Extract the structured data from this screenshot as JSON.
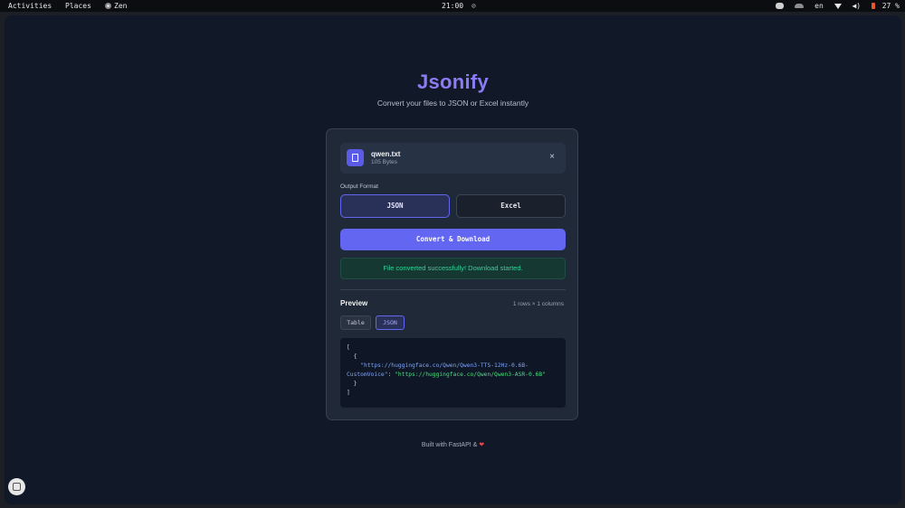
{
  "topbar": {
    "activities": "Activities",
    "places": "Places",
    "app": "Zen",
    "clock": "21:00",
    "language": "en",
    "battery": "27 %"
  },
  "app": {
    "title": "Jsonify",
    "subtitle": "Convert your files to JSON or Excel instantly"
  },
  "file": {
    "name": "qwen.txt",
    "size": "105 Bytes",
    "remove": "×"
  },
  "output": {
    "label": "Output Format",
    "json": "JSON",
    "excel": "Excel",
    "selected": "JSON"
  },
  "convert_label": "Convert & Download",
  "status_message": "File converted successfully! Download started.",
  "preview": {
    "title": "Preview",
    "meta": "1 rows × 1 columns",
    "tabs": [
      "Table",
      "JSON"
    ],
    "active_tab": "JSON",
    "code": {
      "line1": "[",
      "line2": "  {",
      "key": "\"https://huggingface.co/Qwen/Qwen3-TTS-12Hz-0.6B-CustomVoice\"",
      "value": "\"https://huggingface.co/Qwen/Qwen3-ASR-0.6B\"",
      "line4": "  }",
      "line5": "]"
    }
  },
  "footer": {
    "text": "Built with FastAPI & ",
    "heart": "❤"
  },
  "colors": {
    "accent": "#6366f1",
    "title": "#8b7cf6",
    "success": "#34d399",
    "background": "#111827",
    "card": "#1f2937"
  },
  "icons": [
    "zen-icon",
    "discord-icon",
    "cloud-icon",
    "wifi-icon",
    "volume-icon",
    "battery-icon",
    "file-icon",
    "close-icon",
    "heart-icon",
    "extension-icon"
  ]
}
